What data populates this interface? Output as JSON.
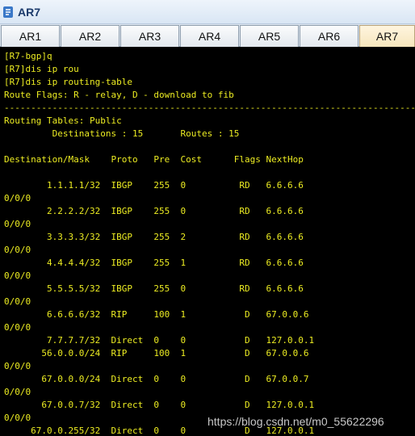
{
  "window": {
    "title": "AR7",
    "icon": "router-app-icon"
  },
  "tabs": [
    {
      "label": "AR1",
      "active": false
    },
    {
      "label": "AR2",
      "active": false
    },
    {
      "label": "AR3",
      "active": false
    },
    {
      "label": "AR4",
      "active": false
    },
    {
      "label": "AR5",
      "active": false
    },
    {
      "label": "AR6",
      "active": false
    },
    {
      "label": "AR7",
      "active": true
    }
  ],
  "terminal": {
    "lines": [
      "[R7-bgp]q",
      "[R7]dis ip rou",
      "[R7]dis ip routing-table",
      "Route Flags: R - relay, D - download to fib",
      "------------------------------------------------------------------------------",
      "Routing Tables: Public",
      "         Destinations : 15       Routes : 15",
      "",
      "Destination/Mask    Proto   Pre  Cost      Flags NextHop",
      "",
      "        1.1.1.1/32  IBGP    255  0          RD   6.6.6.6",
      "0/0/0",
      "        2.2.2.2/32  IBGP    255  0          RD   6.6.6.6",
      "0/0/0",
      "        3.3.3.3/32  IBGP    255  2          RD   6.6.6.6",
      "0/0/0",
      "        4.4.4.4/32  IBGP    255  1          RD   6.6.6.6",
      "0/0/0",
      "        5.5.5.5/32  IBGP    255  0          RD   6.6.6.6",
      "0/0/0",
      "        6.6.6.6/32  RIP     100  1           D   67.0.0.6",
      "0/0/0",
      "        7.7.7.7/32  Direct  0    0           D   127.0.0.1",
      "       56.0.0.0/24  RIP     100  1           D   67.0.0.6",
      "0/0/0",
      "       67.0.0.0/24  Direct  0    0           D   67.0.0.7",
      "0/0/0",
      "       67.0.0.7/32  Direct  0    0           D   127.0.0.1",
      "0/0/0",
      "     67.0.0.255/32  Direct  0    0           D   127.0.0.1"
    ]
  },
  "watermark": "https://blog.csdn.net/m0_55622296",
  "colors": {
    "terminal_bg": "#000000",
    "terminal_text": "#ecec22",
    "active_tab": "#f6e6bd"
  }
}
